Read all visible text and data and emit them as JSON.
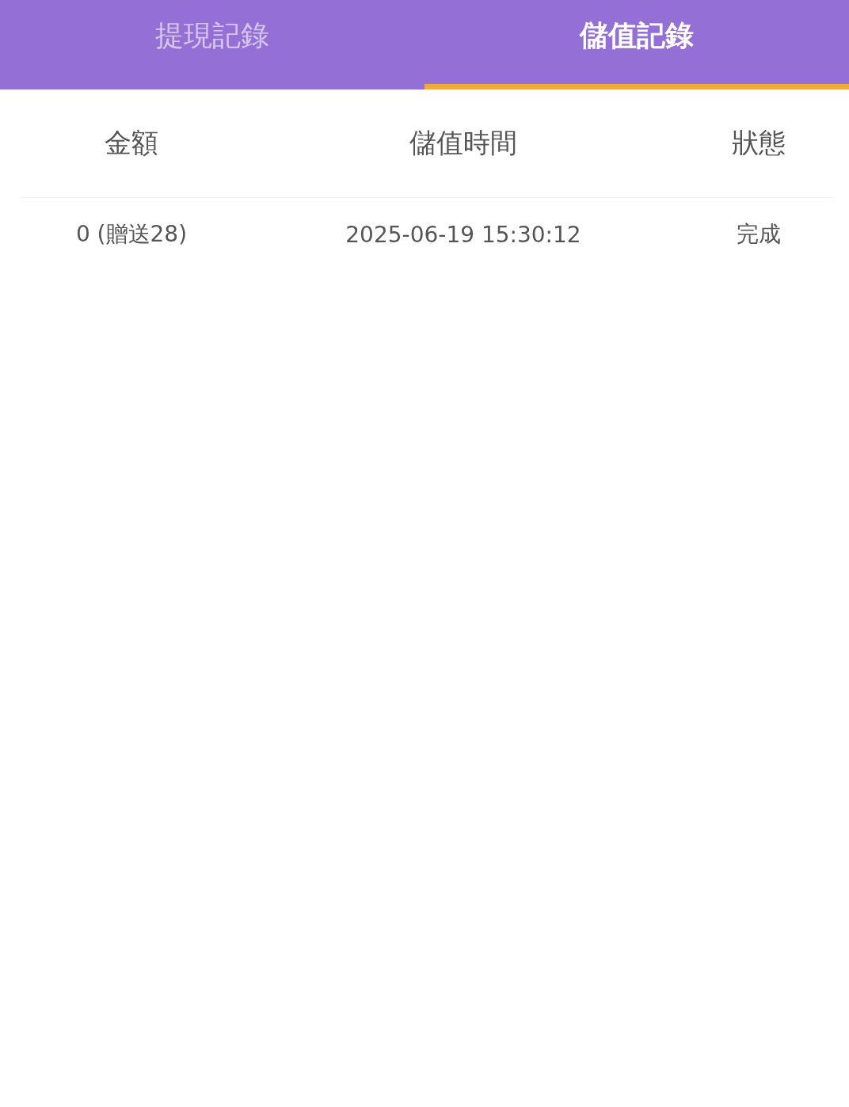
{
  "tabs": [
    {
      "label": "提現記錄",
      "selected": false
    },
    {
      "label": "儲值記錄",
      "selected": true
    }
  ],
  "table": {
    "columns": [
      "金額",
      "儲值時間",
      "狀態"
    ],
    "rows": [
      [
        "0 (贈送28)",
        "2025-06-19 15:30:12",
        "完成"
      ]
    ]
  }
}
